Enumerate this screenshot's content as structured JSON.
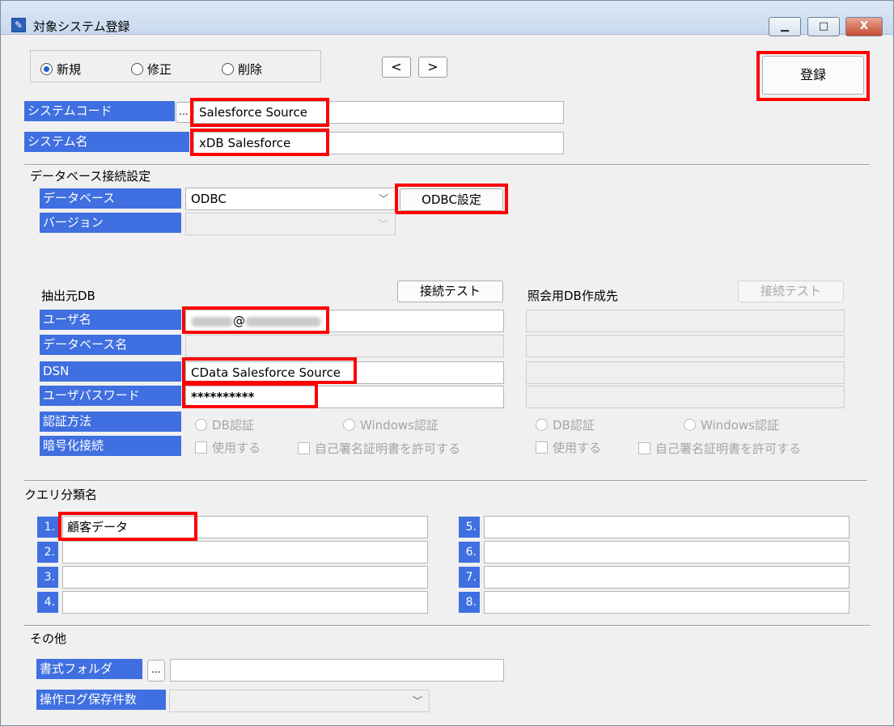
{
  "window": {
    "title": "対象システム登録",
    "controls": {
      "minimize": "▁",
      "maximize": "□",
      "close": "X"
    }
  },
  "mode": {
    "options": [
      "新規",
      "修正",
      "削除"
    ],
    "selected": "新規"
  },
  "nav": {
    "prev": "<",
    "next": ">"
  },
  "register_button": "登録",
  "system": {
    "code_label": "システムコード",
    "code_picker": "...",
    "code_value": "Salesforce Source",
    "name_label": "システム名",
    "name_value": "xDB Salesforce"
  },
  "db_settings": {
    "section_title": "データベース接続設定",
    "database_label": "データベース",
    "database_value": "ODBC",
    "odbc_button": "ODBC設定",
    "version_label": "バージョン",
    "version_value": ""
  },
  "source_db": {
    "title": "抽出元DB",
    "test_button": "接続テスト",
    "user_label": "ユーザ名",
    "user_value_at": "@",
    "dbname_label": "データベース名",
    "dbname_value": "",
    "dsn_label": "DSN",
    "dsn_value": "CData Salesforce Source",
    "password_label": "ユーザパスワード",
    "password_value": "**********",
    "auth_label": "認証方法",
    "auth_options": [
      "DB認証",
      "Windows認証"
    ],
    "encrypt_label": "暗号化接続",
    "encrypt_use": "使用する",
    "encrypt_selfsigned": "自己署名証明書を許可する"
  },
  "query_db": {
    "title": "照会用DB作成先",
    "test_button": "接続テスト",
    "auth_options": [
      "DB認証",
      "Windows認証"
    ],
    "encrypt_use": "使用する",
    "encrypt_selfsigned": "自己署名証明書を許可する"
  },
  "query_categories": {
    "section_title": "クエリ分類名",
    "items": [
      {
        "num": "1.",
        "value": "顧客データ"
      },
      {
        "num": "2.",
        "value": ""
      },
      {
        "num": "3.",
        "value": ""
      },
      {
        "num": "4.",
        "value": ""
      },
      {
        "num": "5.",
        "value": ""
      },
      {
        "num": "6.",
        "value": ""
      },
      {
        "num": "7.",
        "value": ""
      },
      {
        "num": "8.",
        "value": ""
      }
    ]
  },
  "other": {
    "section_title": "その他",
    "format_folder_label": "書式フォルダ",
    "format_folder_picker": "...",
    "format_folder_value": "",
    "log_count_label": "操作ログ保存件数",
    "log_count_value": ""
  },
  "colors": {
    "label_bg": "#3f6fe0",
    "highlight": "#ff0000",
    "window_bg": "#f0f0f0"
  }
}
